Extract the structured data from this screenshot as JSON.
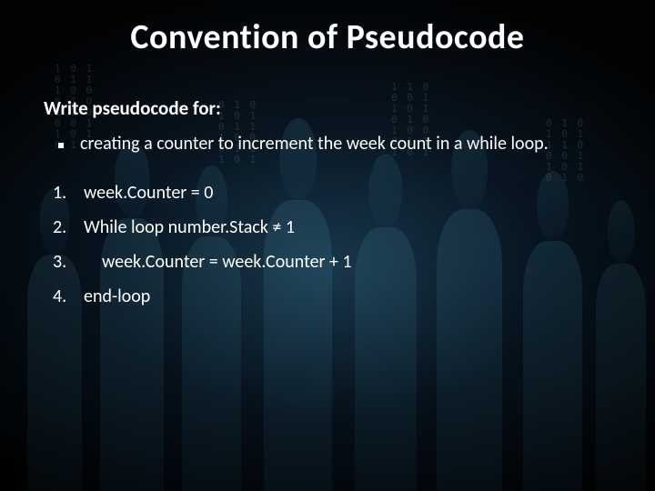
{
  "title": "Convention of Pseudocode",
  "subhead": "Write pseudocode for:",
  "bullet": "creating a counter to increment the week count in a while loop.",
  "steps": [
    "week.Counter = 0",
    "While loop number.Stack ≠ 1",
    "week.Counter = week.Counter + 1",
    "end-loop"
  ]
}
